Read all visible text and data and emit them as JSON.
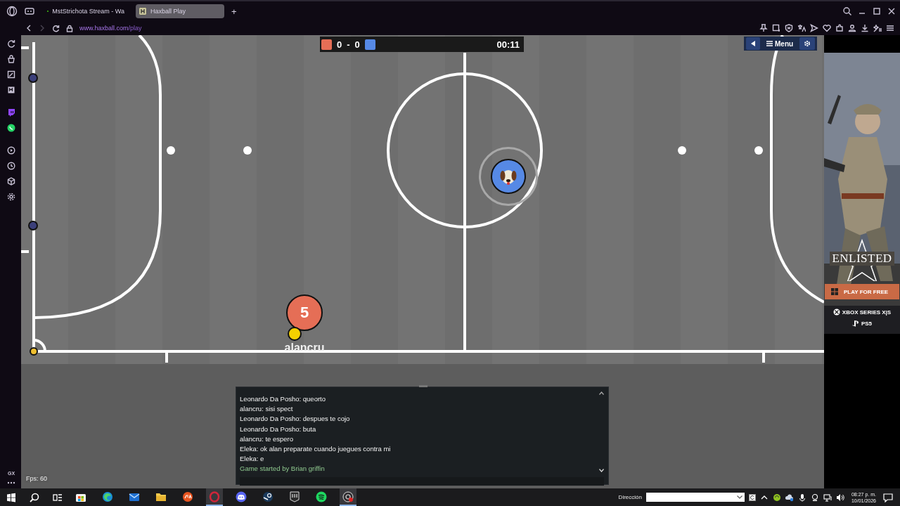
{
  "browser": {
    "tabs": [
      {
        "title": "MstStrichota Stream - Wa",
        "kind": "kick",
        "selected": false
      },
      {
        "title": "Haxball Play",
        "kind": "haxball",
        "selected": true
      }
    ],
    "new_tab": "+",
    "url": {
      "host": "www.haxball.com",
      "path": "/play"
    }
  },
  "sidebar": {
    "footer_label": "GX"
  },
  "scoreboard": {
    "red_score": "0",
    "separator": "-",
    "blue_score": "0",
    "time": "00:11"
  },
  "game_menu": {
    "label": "Menu"
  },
  "players": [
    {
      "color": "#e56e56",
      "number": "5",
      "name": "alancru"
    },
    {
      "color": "#5689e5"
    }
  ],
  "chat": {
    "messages": [
      {
        "kind": "player",
        "text": "Leonardo Da Posho: queorto"
      },
      {
        "kind": "player",
        "text": "alancru: sisi spect"
      },
      {
        "kind": "player",
        "text": "Leonardo Da Posho: despues te cojo"
      },
      {
        "kind": "player",
        "text": "Leonardo Da Posho: buta"
      },
      {
        "kind": "player",
        "text": "alancru: te espero"
      },
      {
        "kind": "player",
        "text": "Eleka: ok alan preparate cuando juegues contra mi"
      },
      {
        "kind": "player",
        "text": "Eleka: e"
      },
      {
        "kind": "system",
        "text": "Game started by Brian griffin"
      }
    ]
  },
  "fps": "Fps: 60",
  "ad": {
    "brand": "ENLISTED",
    "cta": "PLAY FOR FREE",
    "platforms": [
      "XBOX SERIES X|S",
      "PS5"
    ]
  },
  "taskbar": {
    "apps": [
      {
        "kind": "store",
        "active": false
      },
      {
        "kind": "edge",
        "active": false
      },
      {
        "kind": "mail",
        "active": false
      },
      {
        "kind": "folder",
        "active": false
      },
      {
        "kind": "ea",
        "active": false
      },
      {
        "kind": "opera",
        "active": true
      },
      {
        "kind": "discord",
        "active": false
      },
      {
        "kind": "steam",
        "active": false
      },
      {
        "kind": "epic",
        "active": false
      },
      {
        "kind": "spotify",
        "active": false
      },
      {
        "kind": "obs",
        "active": true
      }
    ],
    "address_label": "Dirección",
    "time": "08:27 p. m.",
    "date": "10/01/2026"
  }
}
